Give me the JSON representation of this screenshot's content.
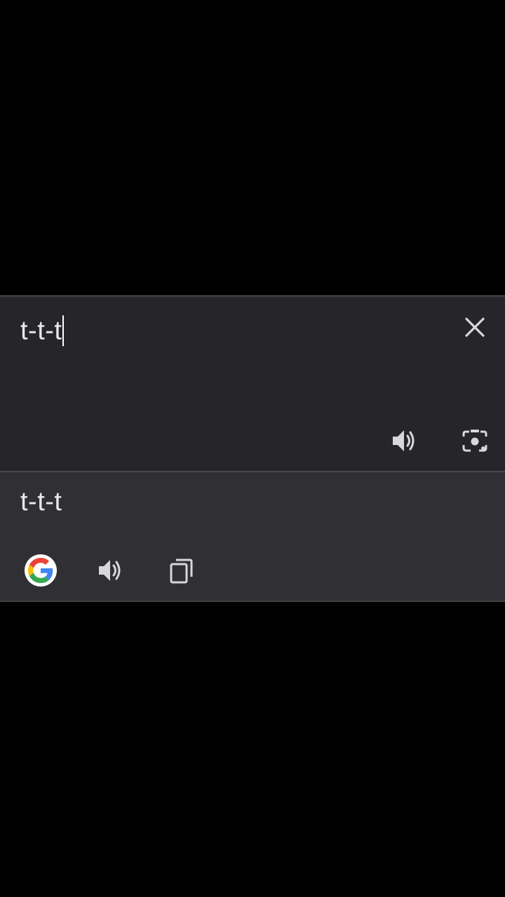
{
  "translator": {
    "source": {
      "text": "t-t-t",
      "clear_icon": "close-icon",
      "speak_icon": "speaker-icon",
      "camera_icon": "lens-camera-icon"
    },
    "result": {
      "text": "t-t-t",
      "google_icon": "google-logo-icon",
      "speak_icon": "speaker-icon",
      "copy_icon": "copy-icon"
    }
  },
  "colors": {
    "background": "#000000",
    "source_panel": "#26262a",
    "result_panel": "#303034",
    "text": "#e8e8ea",
    "icon": "#d8d8da"
  }
}
